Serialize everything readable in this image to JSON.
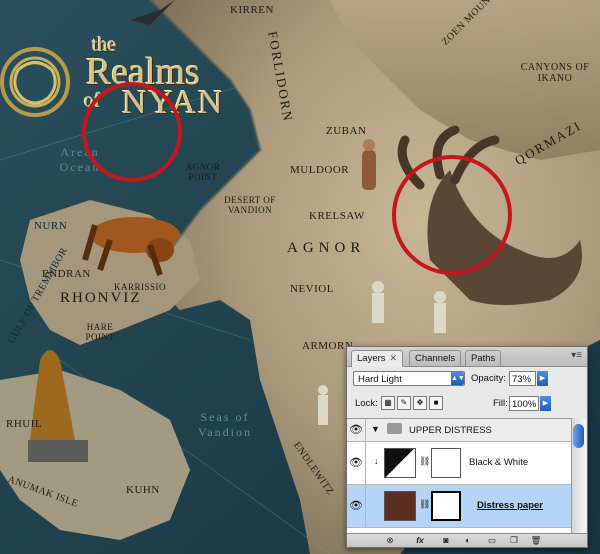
{
  "map": {
    "title": {
      "line1": "the",
      "line2": "Realms",
      "line3": "of",
      "line4": "NYAN"
    },
    "places": {
      "kirren": "KIRREN",
      "forlidorn": "FORLIDORN",
      "zoen_mountains": "ZOEN MOUNTAINS",
      "canyons": "CANYONS OF IKANO",
      "arean_ocean": "Arean Ocean",
      "agnor_point": "AGNOR POINT",
      "zuban": "ZUBAN",
      "muldoor": "MULDOOR",
      "qormazi": "QORMAZI",
      "desert": "DESERT OF VANDION",
      "nurn": "NURN",
      "krelsaw": "KRELSAW",
      "agnor": "AGNOR",
      "endran": "ENDRAN",
      "karrissio": "KARRISSIO",
      "rhonviz": "RHONVIZ",
      "hare_point": "HARE POINT",
      "neviol": "NEVIOL",
      "gulf": "GULF OF TREMMBOR",
      "armorn": "ARMORN",
      "rhuil": "RHUIL",
      "seas": "Seas of Vandion",
      "anumak": "ANUMAK ISLE",
      "kuhn": "KUHN",
      "endlewitz": "ENDLEWITZ"
    }
  },
  "layers_panel": {
    "tabs": [
      {
        "label": "Layers",
        "active": true
      },
      {
        "label": "Channels",
        "active": false
      },
      {
        "label": "Paths",
        "active": false
      }
    ],
    "blend_mode": "Hard Light",
    "opacity_label": "Opacity:",
    "opacity_value": "73%",
    "lock_label": "Lock:",
    "fill_label": "Fill:",
    "fill_value": "100%",
    "layers": [
      {
        "name": "UPPER DISTRESS",
        "type": "group",
        "expanded": true,
        "visible": true
      },
      {
        "name": "Black & White",
        "type": "adjustment",
        "visible": true
      },
      {
        "name": "Distress paper",
        "type": "pixel",
        "visible": true,
        "selected": true
      }
    ],
    "colors": {
      "selected_row": "#b6d4f6",
      "accent": "#1f5dbd"
    }
  }
}
